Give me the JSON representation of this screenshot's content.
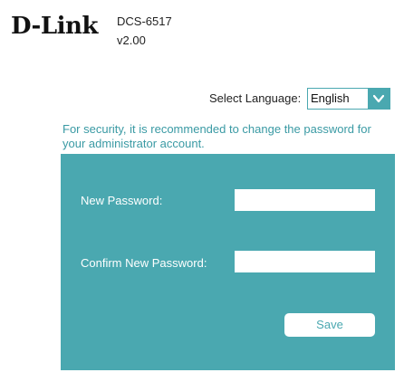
{
  "header": {
    "brand": "D-Link",
    "model": "DCS-6517",
    "version": "v2.00"
  },
  "language": {
    "label": "Select Language:",
    "selected": "English",
    "icon": "chevron-down-icon"
  },
  "notice": "For security, it is recommended to change the password for your administrator account.",
  "form": {
    "new_password_label": "New Password:",
    "new_password_value": "",
    "confirm_password_label": "Confirm New Password:",
    "confirm_password_value": "",
    "save_label": "Save"
  },
  "colors": {
    "accent": "#4aa8b0",
    "notice_text": "#3a9aa4",
    "background": "#ffffff"
  }
}
